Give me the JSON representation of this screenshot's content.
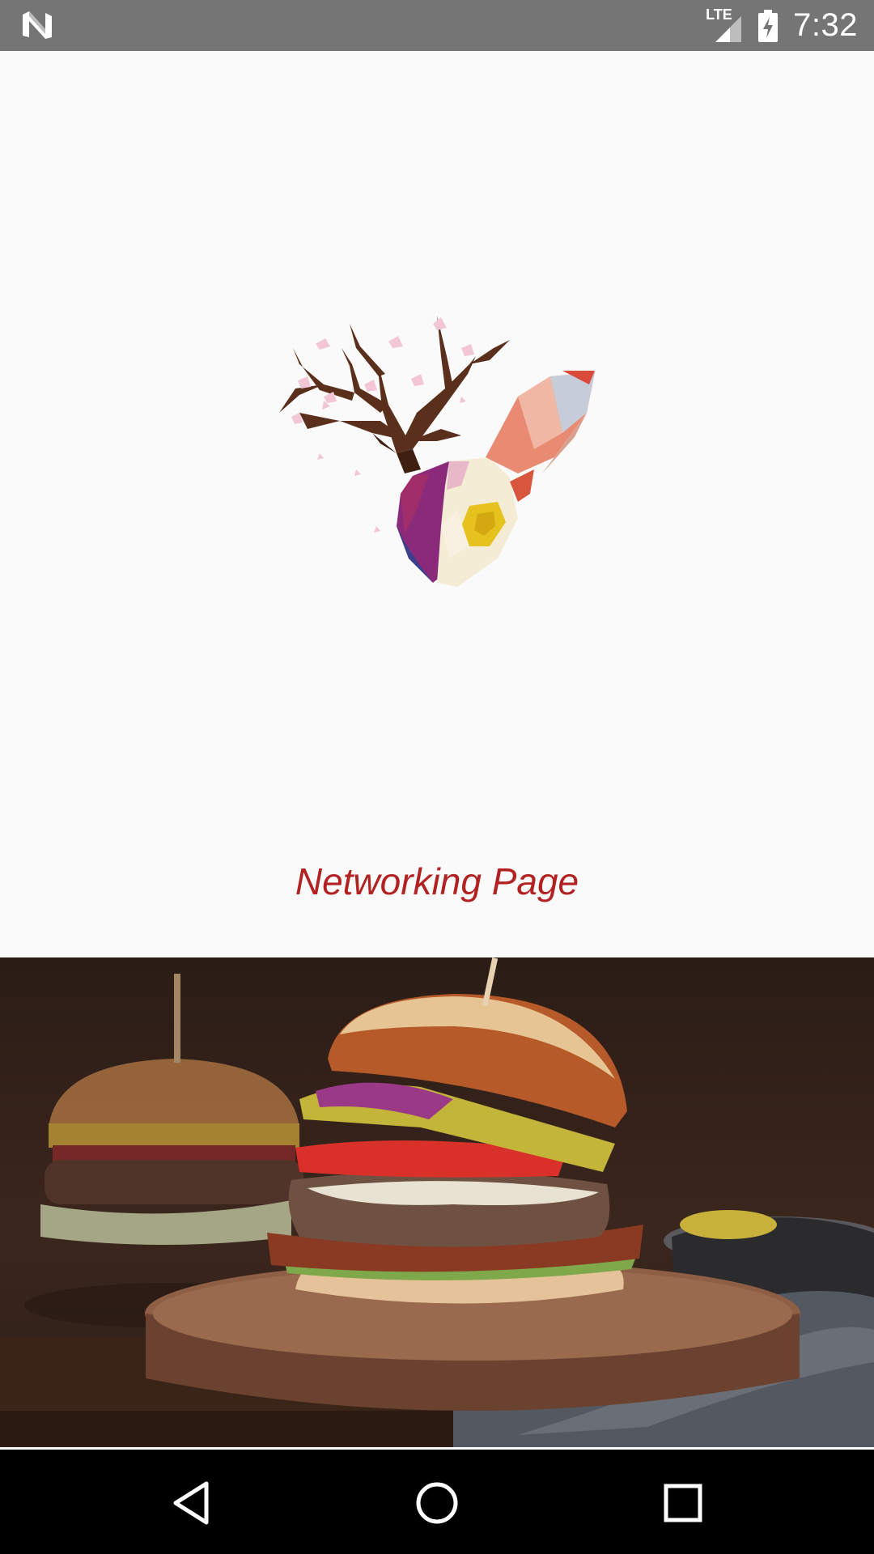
{
  "status_bar": {
    "network_label": "LTE",
    "time": "7:32"
  },
  "main": {
    "title": "Networking Page"
  },
  "colors": {
    "title": "#b22222",
    "status_bar": "#757575",
    "nav_bar": "#000000",
    "background": "#fafafa"
  },
  "icons": {
    "status_logo": "n-logo-icon",
    "signal": "cell-signal-icon",
    "battery": "battery-charging-icon",
    "back": "back-triangle-icon",
    "home": "home-circle-icon",
    "recents": "recents-square-icon"
  }
}
